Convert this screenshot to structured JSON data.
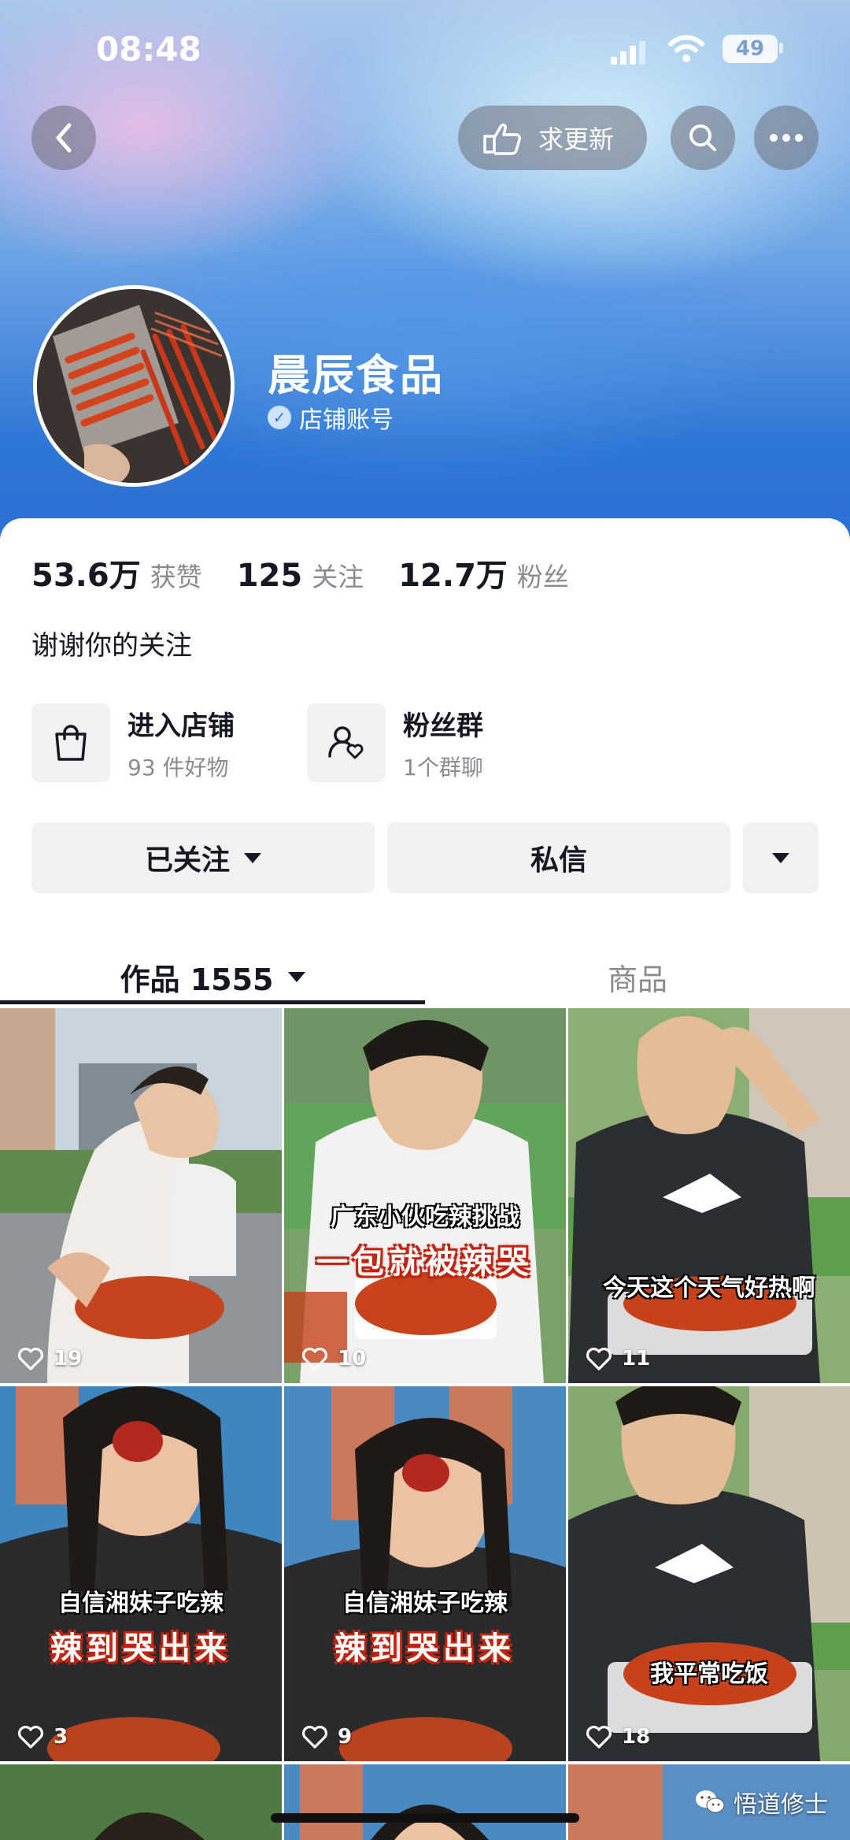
{
  "status_bar": {
    "time": "08:48",
    "battery": "49"
  },
  "top_bar": {
    "update_label": "求更新"
  },
  "profile": {
    "name": "晨辰食品",
    "account_type": "店铺账号"
  },
  "stats": [
    {
      "value": "53.6万",
      "label": "获赞"
    },
    {
      "value": "125",
      "label": "关注"
    },
    {
      "value": "12.7万",
      "label": "粉丝"
    }
  ],
  "bio": "谢谢你的关注",
  "entries": {
    "shop": {
      "title": "进入店铺",
      "subtitle": "93 件好物"
    },
    "fans": {
      "title": "粉丝群",
      "subtitle": "1个群聊"
    }
  },
  "actions": {
    "follow": "已关注",
    "message": "私信"
  },
  "tabs": {
    "works": "作品 1555",
    "goods": "商品"
  },
  "videos": [
    {
      "likes": "19",
      "caption_top": "",
      "caption_main": ""
    },
    {
      "likes": "10",
      "caption_top": "广东小伙吃辣挑战",
      "caption_main": "一包就被辣哭"
    },
    {
      "likes": "11",
      "caption_top": "今天这个天气好热啊",
      "caption_main": ""
    },
    {
      "likes": "3",
      "caption_top": "自信湘妹子吃辣",
      "caption_main": "辣到哭出来"
    },
    {
      "likes": "9",
      "caption_top": "自信湘妹子吃辣",
      "caption_main": "辣到哭出来"
    },
    {
      "likes": "18",
      "caption_top": "我平常吃饭",
      "caption_main": ""
    }
  ],
  "watermark": "悟道修士",
  "colors": {
    "header_blue": "#2f77d6",
    "text_primary": "#161823",
    "text_secondary": "#8a8b91",
    "button_bg": "#f1f1f2"
  }
}
